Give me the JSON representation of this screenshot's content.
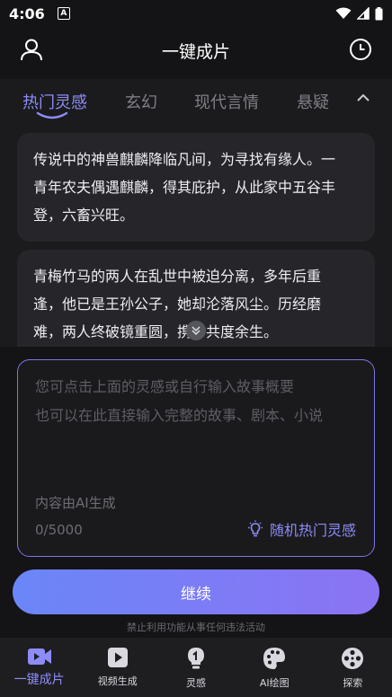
{
  "status_bar": {
    "time": "4:06",
    "app_icon_letter": "A"
  },
  "header": {
    "title": "一键成片",
    "left_icon": "user-icon",
    "right_icon": "clock-icon"
  },
  "tabs": {
    "items": [
      {
        "label": "热门灵感",
        "active": true
      },
      {
        "label": "玄幻",
        "active": false
      },
      {
        "label": "现代言情",
        "active": false
      },
      {
        "label": "悬疑",
        "active": false
      }
    ],
    "collapse_icon": "chevron-up-icon"
  },
  "inspirations": [
    {
      "lines": [
        "传说中的神兽麒麟降临凡间，为寻找有缘人。一",
        "青年农夫偶遇麒麟，得其庇护，从此家中五谷丰",
        "登，六畜兴旺。"
      ]
    },
    {
      "lines": [
        "青梅竹马的两人在乱世中被迫分离，多年后重",
        "逢，他已是王孙公子，她却沦落风尘。历经磨",
        "难，两人终破镜重圆，携手共度余生。"
      ]
    }
  ],
  "story_input": {
    "placeholder_line1": "您可点击上面的灵感或自行输入故事概要",
    "placeholder_line2": "也可以在此直接输入完整的故事、剧本、小说",
    "ai_label": "内容由AI生成",
    "char_count": "0/5000",
    "random_inspiration_label": "随机热门灵感",
    "random_icon": "lightbulb-icon"
  },
  "continue_label": "继续",
  "disclaimer": "禁止利用功能从事任何违法活动",
  "bottom_nav": {
    "items": [
      {
        "label": "一键成片",
        "icon": "video-camera-icon",
        "active": true
      },
      {
        "label": "视频生成",
        "icon": "play-icon",
        "active": false
      },
      {
        "label": "灵感",
        "icon": "lightbulb-icon",
        "active": false
      },
      {
        "label": "AI绘图",
        "icon": "palette-icon",
        "active": false
      },
      {
        "label": "探索",
        "icon": "film-reel-icon",
        "active": false
      }
    ]
  },
  "colors": {
    "accent": "#8d8cf6",
    "background": "#141416",
    "card": "#26262a",
    "button_gradient_start": "#6a86f7",
    "button_gradient_end": "#8c73f4"
  }
}
